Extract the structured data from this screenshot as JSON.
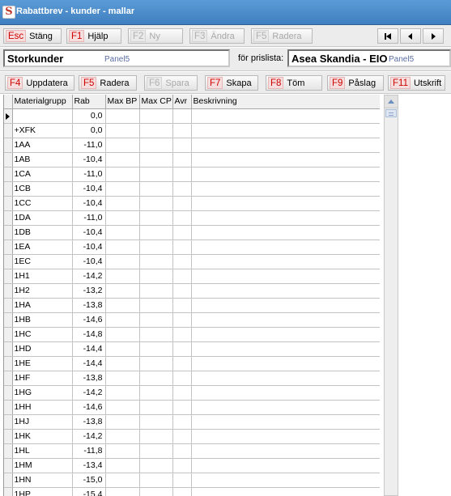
{
  "window": {
    "title": "Rabattbrev - kunder - mallar",
    "app_icon": "S"
  },
  "toolbar": {
    "buttons": [
      {
        "key": "Esc",
        "label": "Stäng",
        "enabled": true
      },
      {
        "key": "F1",
        "label": "Hjälp",
        "enabled": true
      },
      {
        "key": "F2",
        "label": "Ny",
        "enabled": false
      },
      {
        "key": "F3",
        "label": "Ändra",
        "enabled": false
      },
      {
        "key": "F5",
        "label": "Radera",
        "enabled": false
      }
    ],
    "nav": [
      "first-icon",
      "prev-icon",
      "next-icon"
    ]
  },
  "info": {
    "customer_group": "Storkunder",
    "customer_panel_label": "Panel5",
    "pricelist_label": "för prislista:",
    "pricelist": "Asea Skandia - EIO",
    "pricelist_panel_label": "Panel5"
  },
  "actions": {
    "buttons": [
      {
        "key": "F4",
        "label": "Uppdatera",
        "enabled": true
      },
      {
        "key": "F5",
        "label": "Radera",
        "enabled": true
      },
      {
        "key": "F6",
        "label": "Spara",
        "enabled": false
      },
      {
        "key": "F7",
        "label": "Skapa",
        "enabled": true
      },
      {
        "key": "F8",
        "label": "Töm",
        "enabled": true
      },
      {
        "key": "F9",
        "label": "Påslag",
        "enabled": true
      },
      {
        "key": "F11",
        "label": "Utskrift",
        "enabled": true
      }
    ]
  },
  "grid": {
    "columns": [
      "Materialgrupp",
      "Rab",
      "Max BP",
      "Max CP",
      "Avr",
      "Beskrivning"
    ],
    "rows": [
      {
        "group": "",
        "rab": "0,0",
        "current": true
      },
      {
        "group": "+XFK",
        "rab": "0,0"
      },
      {
        "group": "1AA",
        "rab": "-11,0"
      },
      {
        "group": "1AB",
        "rab": "-10,4"
      },
      {
        "group": "1CA",
        "rab": "-11,0"
      },
      {
        "group": "1CB",
        "rab": "-10,4"
      },
      {
        "group": "1CC",
        "rab": "-10,4"
      },
      {
        "group": "1DA",
        "rab": "-11,0"
      },
      {
        "group": "1DB",
        "rab": "-10,4"
      },
      {
        "group": "1EA",
        "rab": "-10,4"
      },
      {
        "group": "1EC",
        "rab": "-10,4"
      },
      {
        "group": "1H1",
        "rab": "-14,2"
      },
      {
        "group": "1H2",
        "rab": "-13,2"
      },
      {
        "group": "1HA",
        "rab": "-13,8"
      },
      {
        "group": "1HB",
        "rab": "-14,6"
      },
      {
        "group": "1HC",
        "rab": "-14,8"
      },
      {
        "group": "1HD",
        "rab": "-14,4"
      },
      {
        "group": "1HE",
        "rab": "-14,4"
      },
      {
        "group": "1HF",
        "rab": "-13,8"
      },
      {
        "group": "1HG",
        "rab": "-14,2"
      },
      {
        "group": "1HH",
        "rab": "-14,6"
      },
      {
        "group": "1HJ",
        "rab": "-13,8"
      },
      {
        "group": "1HK",
        "rab": "-14,2"
      },
      {
        "group": "1HL",
        "rab": "-11,8"
      },
      {
        "group": "1HM",
        "rab": "-13,4"
      },
      {
        "group": "1HN",
        "rab": "-15,0"
      },
      {
        "group": "1HP",
        "rab": "-15,4"
      }
    ]
  }
}
